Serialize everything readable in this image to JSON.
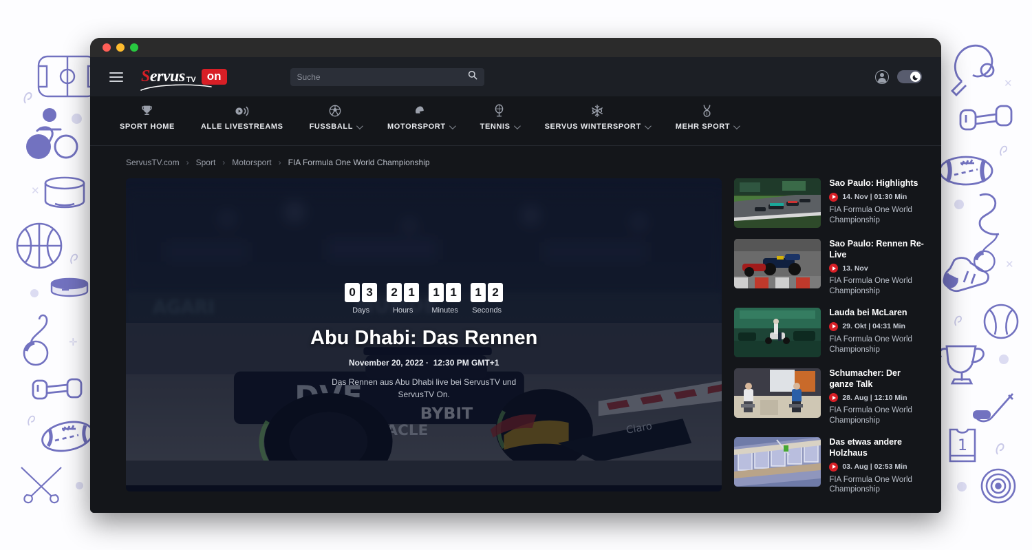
{
  "window": {
    "traffic_lights": [
      "close",
      "minimize",
      "maximize"
    ]
  },
  "header": {
    "menu_icon": "hamburger-icon",
    "logo": {
      "word": "ervus",
      "initial": "S",
      "tv": "TV",
      "badge": "on"
    },
    "search": {
      "placeholder": "Suche",
      "value": "",
      "icon": "search-icon"
    },
    "account_icon": "user-avatar-icon",
    "theme_toggle": {
      "state": "dark",
      "icon": "moon-icon"
    }
  },
  "nav": {
    "items": [
      {
        "label": "SPORT HOME",
        "icon": "trophy-icon",
        "dropdown": false
      },
      {
        "label": "ALLE LIVESTREAMS",
        "icon": "livestream-icon",
        "dropdown": false
      },
      {
        "label": "FUSSBALL",
        "icon": "soccer-ball-icon",
        "dropdown": true
      },
      {
        "label": "MOTORSPORT",
        "icon": "racing-helmet-icon",
        "dropdown": true
      },
      {
        "label": "TENNIS",
        "icon": "tennis-racket-icon",
        "dropdown": true
      },
      {
        "label": "SERVUS WINTERSPORT",
        "icon": "snowflake-icon",
        "dropdown": true
      },
      {
        "label": "MEHR SPORT",
        "icon": "boxing-gloves-icon",
        "dropdown": true
      }
    ]
  },
  "breadcrumb": {
    "items": [
      "ServusTV.com",
      "Sport",
      "Motorsport",
      "FIA Formula One World Championship"
    ],
    "separator": "›"
  },
  "hero": {
    "title": "Abu Dhabi: Das Rennen",
    "date": "November 20, 2022",
    "date_separator": "·",
    "time": "12:30 PM GMT+1",
    "description": "Das Rennen aus Abu Dhabi live bei ServusTV und ServusTV On.",
    "countdown": [
      {
        "label": "Days",
        "digits": [
          "0",
          "3"
        ]
      },
      {
        "label": "Hours",
        "digits": [
          "2",
          "1"
        ]
      },
      {
        "label": "Minutes",
        "digits": [
          "1",
          "1"
        ]
      },
      {
        "label": "Seconds",
        "digits": [
          "1",
          "2"
        ]
      }
    ],
    "image_alt": "formula-one-car-on-track"
  },
  "playlist": {
    "items": [
      {
        "title": "Sao Paulo: Highlights",
        "date": "14. Nov",
        "duration": "01:30 Min",
        "meta": "14. Nov | 01:30 Min",
        "category": "FIA Formula One World Championship",
        "thumb": "f1-race-start-grid"
      },
      {
        "title": "Sao Paulo: Rennen Re-Live",
        "date": "13. Nov",
        "duration": "",
        "meta": "13. Nov",
        "category": "FIA Formula One World Championship",
        "thumb": "f1-red-bull-overtake"
      },
      {
        "title": "Lauda bei McLaren",
        "date": "29. Okt",
        "duration": "04:31 Min",
        "meta": "29. Okt | 04:31 Min",
        "category": "FIA Formula One World Championship",
        "thumb": "mclaren-garage-green"
      },
      {
        "title": "Schumacher: Der ganze Talk",
        "date": "28. Aug",
        "duration": "12:10 Min",
        "meta": "28. Aug | 12:10 Min",
        "category": "FIA Formula One World Championship",
        "thumb": "two-drivers-interview"
      },
      {
        "title": "Das etwas andere Holzhaus",
        "date": "03. Aug",
        "duration": "02:53 Min",
        "meta": "03. Aug | 02:53 Min",
        "category": "FIA Formula One World Championship",
        "thumb": "wooden-house-construction"
      }
    ]
  },
  "background": {
    "theme": "sports-doodles",
    "color": "#6b6bbd",
    "doodles_left": [
      "soccer-field-icon",
      "cyclist-icon",
      "drum-icon",
      "basketball-icon",
      "hockey-puck-icon",
      "whistle-icon",
      "dumbbell-icon",
      "american-football-icon",
      "crossed-fencing-swords-icon"
    ],
    "doodles_right": [
      "ping-pong-paddle-icon",
      "dumbbell-icon",
      "american-football-icon",
      "boomerang-icon",
      "whistle-icon",
      "boxing-glove-icon",
      "baseball-icon",
      "trophy-icon",
      "hockey-stick-icon",
      "jersey-number-1-icon",
      "dartboard-icon"
    ]
  },
  "colors": {
    "brand_red": "#d81f26",
    "page_bg": "#14161a",
    "header_bg": "#1c1f25",
    "doodle_purple": "#6b6bbd"
  }
}
